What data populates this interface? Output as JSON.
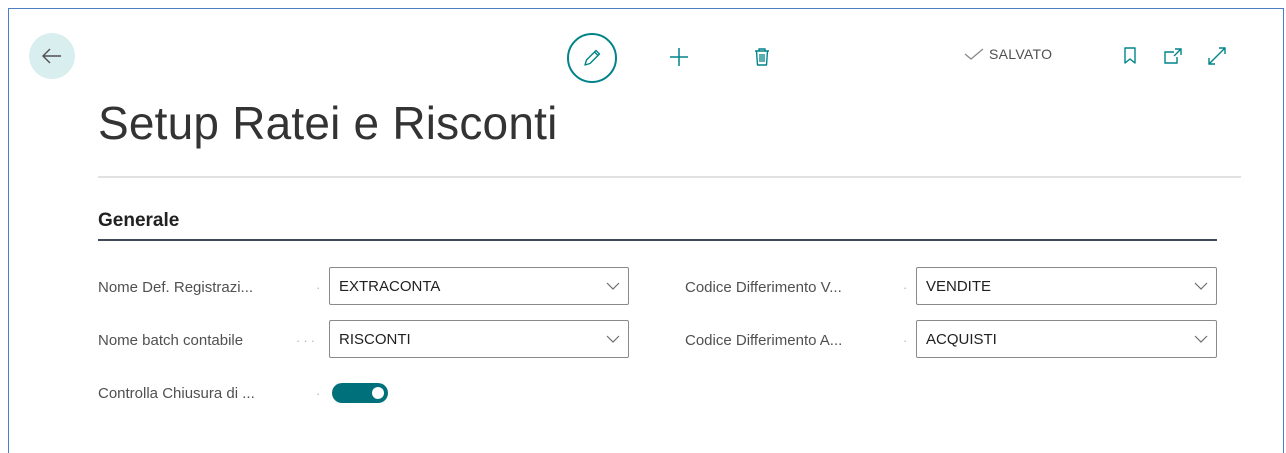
{
  "header": {
    "status_text": "SALVATO"
  },
  "page": {
    "title": "Setup Ratei e Risconti"
  },
  "section": {
    "title": "Generale"
  },
  "fields": {
    "nome_def_registrazione": {
      "label": "Nome Def. Registrazi...",
      "value": "EXTRACONTA"
    },
    "nome_batch_contabile": {
      "label": "Nome batch contabile",
      "value": "RISCONTI"
    },
    "controlla_chiusura": {
      "label": "Controlla Chiusura di ...",
      "enabled": true
    },
    "codice_differimento_vendite": {
      "label": "Codice Differimento V...",
      "value": "VENDITE"
    },
    "codice_differimento_acquisti": {
      "label": "Codice Differimento A...",
      "value": "ACQUISTI"
    }
  },
  "colors": {
    "accent": "#008489",
    "toggle_on": "#00707a",
    "back_button_bg": "#d9eeef"
  },
  "icons": [
    "back-arrow-icon",
    "pencil-icon",
    "plus-icon",
    "trash-icon",
    "check-icon",
    "bookmark-icon",
    "open-in-new-window-icon",
    "expand-icon",
    "chevron-down-icon"
  ]
}
